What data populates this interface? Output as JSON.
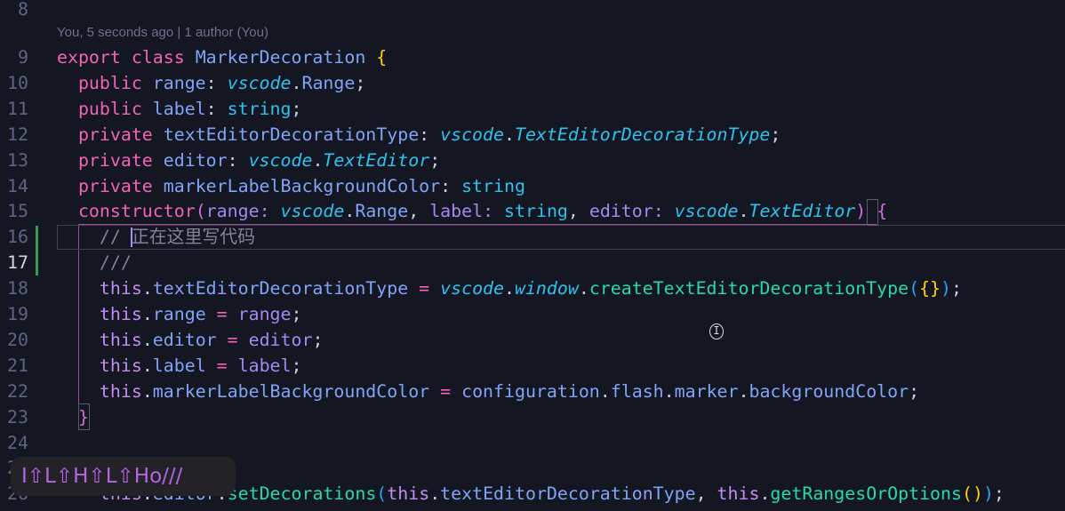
{
  "blame": "You, 5 seconds ago | 1 author (You)",
  "active_line": "17",
  "popup_text": "I⇧L⇧H⇧L⇧Ho///",
  "lines": [
    {
      "n": "8",
      "t": []
    },
    {
      "n": "9",
      "t": [
        [
          "export ",
          "kw"
        ],
        [
          "class ",
          "kw"
        ],
        [
          "MarkerDecoration ",
          "id"
        ],
        [
          "{",
          "br"
        ]
      ]
    },
    {
      "n": "10",
      "t": [
        [
          "  public ",
          "kw"
        ],
        [
          "range",
          "id"
        ],
        [
          ": ",
          "p"
        ],
        [
          "vscode",
          "ns"
        ],
        [
          ".",
          "p"
        ],
        [
          "Range",
          "id"
        ],
        [
          ";",
          "p"
        ]
      ]
    },
    {
      "n": "11",
      "t": [
        [
          "  public ",
          "kw"
        ],
        [
          "label",
          "id"
        ],
        [
          ": ",
          "p"
        ],
        [
          "string",
          "ty"
        ],
        [
          ";",
          "p"
        ]
      ]
    },
    {
      "n": "12",
      "t": [
        [
          "  private ",
          "kw"
        ],
        [
          "textEditorDecorationType",
          "id"
        ],
        [
          ": ",
          "p"
        ],
        [
          "vscode",
          "ns"
        ],
        [
          ".",
          "p"
        ],
        [
          "TextEditorDecorationType",
          "ns"
        ],
        [
          ";",
          "p"
        ]
      ]
    },
    {
      "n": "13",
      "t": [
        [
          "  private ",
          "kw"
        ],
        [
          "editor",
          "id"
        ],
        [
          ": ",
          "p"
        ],
        [
          "vscode",
          "ns"
        ],
        [
          ".",
          "p"
        ],
        [
          "TextEditor",
          "ns"
        ],
        [
          ";",
          "p"
        ]
      ]
    },
    {
      "n": "14",
      "t": [
        [
          "  private ",
          "kw"
        ],
        [
          "markerLabelBackgroundColor",
          "id"
        ],
        [
          ": ",
          "p"
        ],
        [
          "string",
          "ty"
        ]
      ]
    },
    {
      "n": "15",
      "t": [
        [
          "  constructor",
          "kw"
        ],
        [
          "(",
          "bk"
        ],
        [
          "range",
          "param"
        ],
        [
          ": ",
          "param"
        ],
        [
          "vscode",
          "ns"
        ],
        [
          ".",
          "p"
        ],
        [
          "Range",
          "id"
        ],
        [
          ", ",
          "p"
        ],
        [
          "label",
          "param"
        ],
        [
          ": ",
          "param"
        ],
        [
          "string",
          "ty"
        ],
        [
          ", ",
          "p"
        ],
        [
          "editor",
          "param"
        ],
        [
          ": ",
          "param"
        ],
        [
          "vscode",
          "ns"
        ],
        [
          ".",
          "p"
        ],
        [
          "TextEditor",
          "ns"
        ],
        [
          ") ",
          "bk"
        ],
        [
          "{",
          "bk"
        ]
      ]
    },
    {
      "n": "16",
      "t": [
        [
          "    // 正在这里写代码",
          "cm"
        ]
      ]
    },
    {
      "n": "17",
      "t": [
        [
          "    ///",
          "cm"
        ]
      ]
    },
    {
      "n": "18",
      "t": [
        [
          "    this",
          "th"
        ],
        [
          ".",
          "p"
        ],
        [
          "textEditorDecorationType",
          "id"
        ],
        [
          " = ",
          "op"
        ],
        [
          "vscode",
          "ns"
        ],
        [
          ".",
          "p"
        ],
        [
          "window",
          "ns"
        ],
        [
          ".",
          "p"
        ],
        [
          "createTextEditorDecorationType",
          "fn"
        ],
        [
          "(",
          "br2"
        ],
        [
          "{}",
          "br"
        ],
        [
          ")",
          "br2"
        ],
        [
          ";",
          "p"
        ]
      ]
    },
    {
      "n": "19",
      "t": [
        [
          "    this",
          "th"
        ],
        [
          ".",
          "p"
        ],
        [
          "range",
          "id"
        ],
        [
          " = ",
          "op"
        ],
        [
          "range",
          "param"
        ],
        [
          ";",
          "p"
        ]
      ]
    },
    {
      "n": "20",
      "t": [
        [
          "    this",
          "th"
        ],
        [
          ".",
          "p"
        ],
        [
          "editor",
          "id"
        ],
        [
          " = ",
          "op"
        ],
        [
          "editor",
          "param"
        ],
        [
          ";",
          "p"
        ]
      ]
    },
    {
      "n": "21",
      "t": [
        [
          "    this",
          "th"
        ],
        [
          ".",
          "p"
        ],
        [
          "label",
          "id"
        ],
        [
          " = ",
          "op"
        ],
        [
          "label",
          "param"
        ],
        [
          ";",
          "p"
        ]
      ]
    },
    {
      "n": "22",
      "t": [
        [
          "    this",
          "th"
        ],
        [
          ".",
          "p"
        ],
        [
          "markerLabelBackgroundColor",
          "id"
        ],
        [
          " = ",
          "op"
        ],
        [
          "configuration",
          "id"
        ],
        [
          ".",
          "p"
        ],
        [
          "flash",
          "id"
        ],
        [
          ".",
          "p"
        ],
        [
          "marker",
          "id"
        ],
        [
          ".",
          "p"
        ],
        [
          "backgroundColor",
          "id"
        ],
        [
          ";",
          "p"
        ]
      ]
    },
    {
      "n": "23",
      "t": [
        [
          "  }",
          "bk"
        ]
      ]
    },
    {
      "n": "24",
      "t": []
    },
    {
      "n": "25",
      "t": []
    },
    {
      "n": "26",
      "t": [
        [
          "    this",
          "th"
        ],
        [
          ".",
          "p"
        ],
        [
          "editor",
          "id"
        ],
        [
          ".",
          "p"
        ],
        [
          "setDecorations",
          "fn"
        ],
        [
          "(",
          "br2"
        ],
        [
          "this",
          "th"
        ],
        [
          ".",
          "p"
        ],
        [
          "textEditorDecorationType",
          "id"
        ],
        [
          ", ",
          "p"
        ],
        [
          "this",
          "th"
        ],
        [
          ".",
          "p"
        ],
        [
          "getRangesOrOptions",
          "fn"
        ],
        [
          "()",
          "br"
        ],
        [
          ")",
          "br2"
        ],
        [
          ";",
          "p"
        ]
      ]
    }
  ]
}
